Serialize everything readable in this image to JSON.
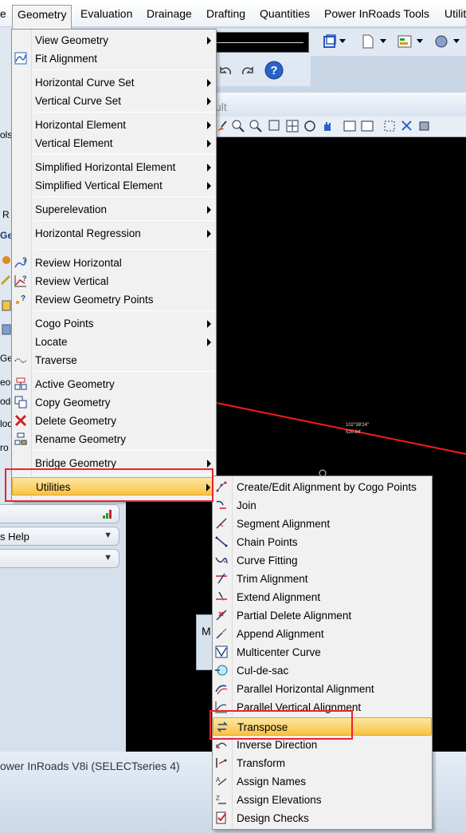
{
  "menubar": {
    "items": [
      "e",
      "Geometry",
      "Evaluation",
      "Drainage",
      "Drafting",
      "Quantities",
      "Power InRoads Tools",
      "Utilit"
    ]
  },
  "geometry_menu": {
    "items": [
      {
        "label": "View Geometry",
        "submenu": true,
        "icon": "none"
      },
      {
        "label": "Fit Alignment",
        "submenu": false,
        "icon": "fit-alignment-icon"
      },
      {
        "label": "Horizontal Curve Set",
        "submenu": true,
        "icon": "none"
      },
      {
        "label": "Vertical Curve Set",
        "submenu": true,
        "icon": "none"
      },
      {
        "label": "Horizontal Element",
        "submenu": true,
        "icon": "none"
      },
      {
        "label": "Vertical Element",
        "submenu": true,
        "icon": "none"
      },
      {
        "label": "Simplified Horizontal Element",
        "submenu": true,
        "icon": "none"
      },
      {
        "label": "Simplified Vertical Element",
        "submenu": true,
        "icon": "none"
      },
      {
        "label": "Superelevation",
        "submenu": true,
        "icon": "none"
      },
      {
        "label": "Horizontal Regression",
        "submenu": true,
        "icon": "none"
      },
      {
        "label": "Review Horizontal",
        "submenu": false,
        "icon": "review-horizontal-icon"
      },
      {
        "label": "Review Vertical",
        "submenu": false,
        "icon": "review-vertical-icon"
      },
      {
        "label": "Review Geometry Points",
        "submenu": false,
        "icon": "review-points-icon"
      },
      {
        "label": "Cogo Points",
        "submenu": true,
        "icon": "none"
      },
      {
        "label": "Locate",
        "submenu": true,
        "icon": "none"
      },
      {
        "label": "Traverse",
        "submenu": false,
        "icon": "traverse-icon"
      },
      {
        "label": "Active Geometry",
        "submenu": false,
        "icon": "active-geometry-icon"
      },
      {
        "label": "Copy Geometry",
        "submenu": false,
        "icon": "copy-geometry-icon"
      },
      {
        "label": "Delete Geometry",
        "submenu": false,
        "icon": "delete-geometry-icon"
      },
      {
        "label": "Rename Geometry",
        "submenu": false,
        "icon": "rename-geometry-icon"
      },
      {
        "label": "Bridge Geometry",
        "submenu": true,
        "icon": "none"
      },
      {
        "label": "Utilities",
        "submenu": true,
        "icon": "none",
        "highlighted": true
      }
    ]
  },
  "utilities_submenu": {
    "items": [
      {
        "label": "Create/Edit Alignment by Cogo Points",
        "icon": "cogo-alignment-icon"
      },
      {
        "label": "Join",
        "icon": "join-icon"
      },
      {
        "label": "Segment Alignment",
        "icon": "segment-alignment-icon"
      },
      {
        "label": "Chain Points",
        "icon": "chain-points-icon"
      },
      {
        "label": "Curve Fitting",
        "icon": "curve-fitting-icon"
      },
      {
        "label": "Trim Alignment",
        "icon": "trim-alignment-icon"
      },
      {
        "label": "Extend Alignment",
        "icon": "extend-alignment-icon"
      },
      {
        "label": "Partial Delete Alignment",
        "icon": "partial-delete-icon"
      },
      {
        "label": "Append Alignment",
        "icon": "append-alignment-icon"
      },
      {
        "label": "Multicenter Curve",
        "icon": "multicenter-curve-icon"
      },
      {
        "label": "Cul-de-sac",
        "icon": "cul-de-sac-icon"
      },
      {
        "label": "Parallel Horizontal Alignment",
        "icon": "parallel-horizontal-icon"
      },
      {
        "label": "Parallel Vertical Alignment",
        "icon": "parallel-vertical-icon"
      },
      {
        "label": "Transpose",
        "icon": "transpose-icon",
        "highlighted": true
      },
      {
        "label": "Inverse Direction",
        "icon": "inverse-direction-icon"
      },
      {
        "label": "Transform",
        "icon": "transform-icon"
      },
      {
        "label": "Assign Names",
        "icon": "assign-names-icon"
      },
      {
        "label": "Assign Elevations",
        "icon": "assign-elevations-icon"
      },
      {
        "label": "Design Checks",
        "icon": "design-checks-icon"
      }
    ]
  },
  "background": {
    "view_title_fragment": "ult",
    "left_fragments": [
      "ols",
      "R",
      "Ge",
      "Ge",
      "eo",
      "ode",
      "lod",
      "ro"
    ],
    "panel_rows": [
      "",
      "s Help",
      ""
    ],
    "mini_label": "M",
    "viewport_text_1": "102°38'24\"",
    "viewport_text_2": "520.84'",
    "status_text": "ower InRoads V8i (SELECTseries 4)"
  },
  "colors": {
    "highlight_top": "#fde7a3",
    "highlight_bottom": "#f8c245",
    "annotation_red": "#e8262b",
    "alignment_line": "#ff1a1a",
    "viewport": "#000000"
  }
}
